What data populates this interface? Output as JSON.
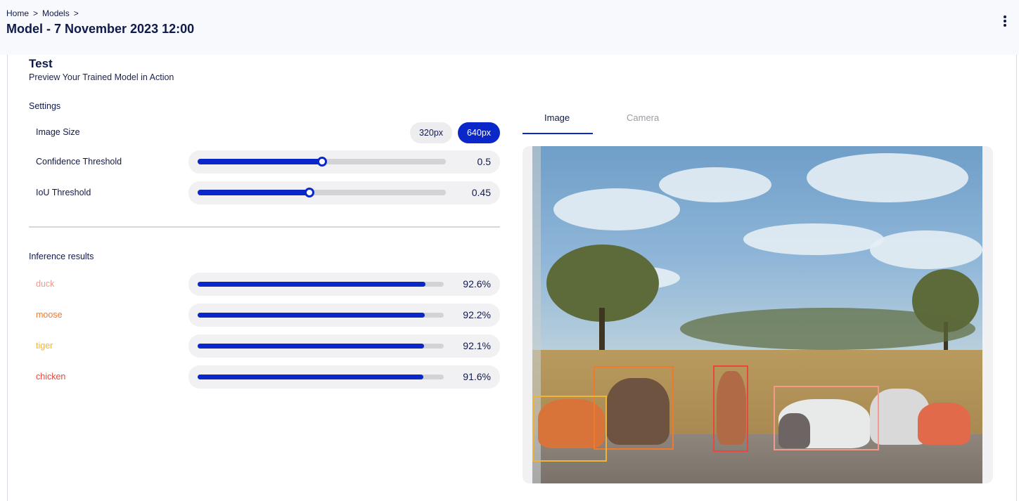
{
  "header": {
    "breadcrumb": [
      "Home",
      ">",
      "Models",
      ">"
    ],
    "title": "Model - 7 November 2023 12:00"
  },
  "test": {
    "title": "Test",
    "subtitle": "Preview Your Trained Model in Action"
  },
  "settings": {
    "heading": "Settings",
    "image_size": {
      "label": "Image Size",
      "options": [
        "320px",
        "640px"
      ],
      "selected": "640px"
    },
    "confidence": {
      "label": "Confidence Threshold",
      "value": 0.5,
      "display": "0.5"
    },
    "iou": {
      "label": "IoU Threshold",
      "value": 0.45,
      "display": "0.45"
    }
  },
  "inference": {
    "heading": "Inference results",
    "results": [
      {
        "label": "duck",
        "score": 0.926,
        "display": "92.6%",
        "color": "#f29a8c"
      },
      {
        "label": "moose",
        "score": 0.922,
        "display": "92.2%",
        "color": "#f07a2a"
      },
      {
        "label": "tiger",
        "score": 0.921,
        "display": "92.1%",
        "color": "#f0b43a"
      },
      {
        "label": "chicken",
        "score": 0.916,
        "display": "91.6%",
        "color": "#e8473f"
      }
    ]
  },
  "preview": {
    "tabs": [
      "Image",
      "Camera"
    ],
    "active_tab": "Image"
  },
  "colors": {
    "accent": "#0a28c9",
    "text": "#0f1a4a"
  }
}
